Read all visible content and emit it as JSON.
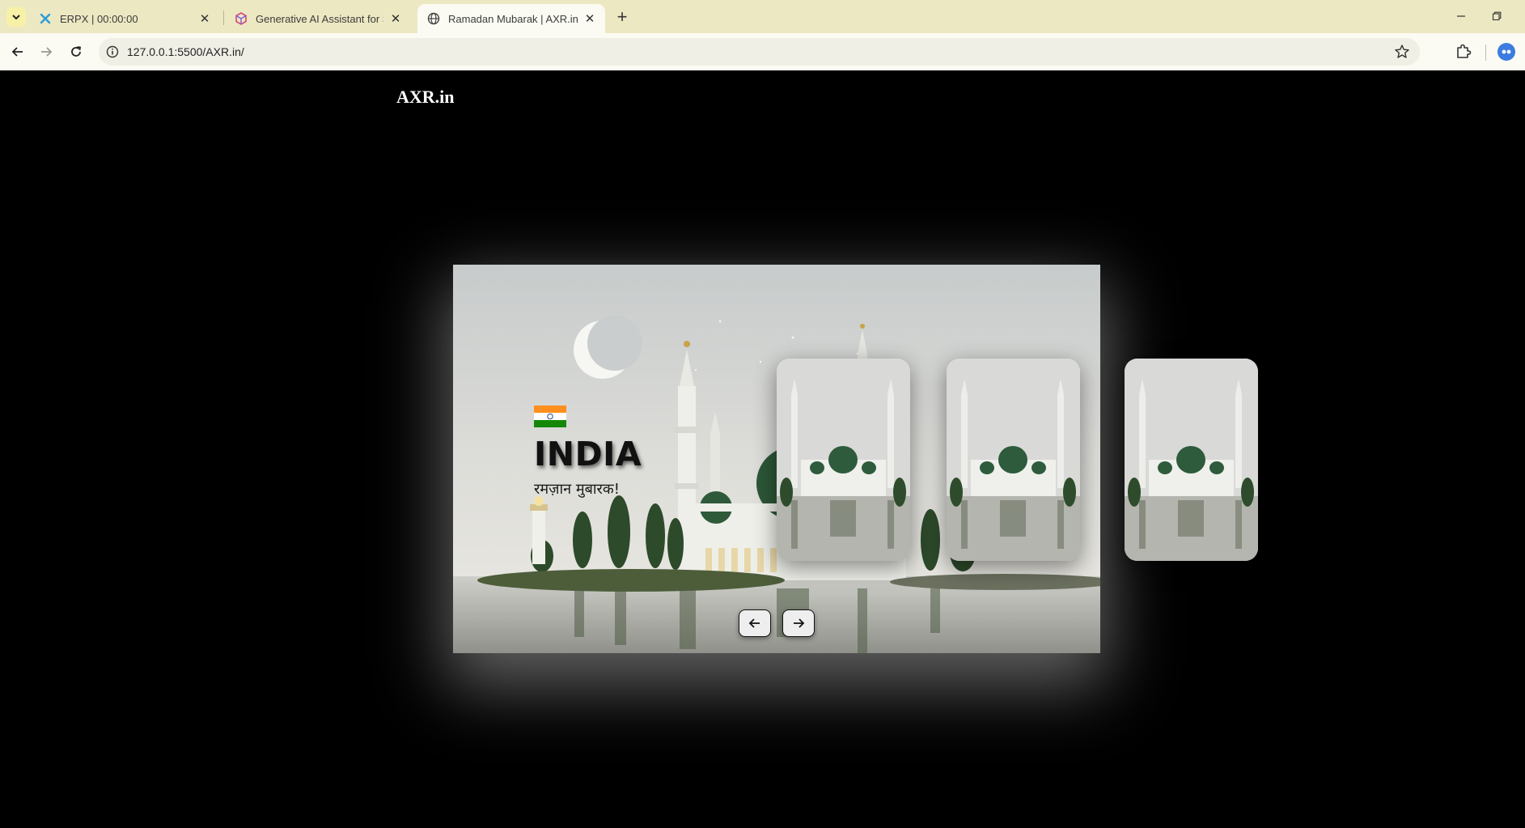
{
  "browser": {
    "tabs": [
      {
        "title": "ERPX | 00:00:00",
        "icon": "vscode-live-icon",
        "active": false
      },
      {
        "title": "Generative AI Assistant for Soft",
        "icon": "cube-icon",
        "active": false
      },
      {
        "title": "Ramadan Mubarak | AXR.in",
        "icon": "globe-icon",
        "active": true
      }
    ],
    "address": "127.0.0.1:5500/AXR.in/"
  },
  "page": {
    "logo": "AXR.in",
    "hero": {
      "country": "INDIA",
      "greeting": "रमज़ान मुबारक!",
      "flag": "india-flag"
    },
    "controls": {
      "prev_icon": "arrow-left-icon",
      "next_icon": "arrow-right-icon"
    }
  },
  "colors": {
    "tabbar": "#ece8c2",
    "toolbar": "#fbfbf3",
    "page_bg": "#000000",
    "dome_green": "#2f5a3a"
  }
}
